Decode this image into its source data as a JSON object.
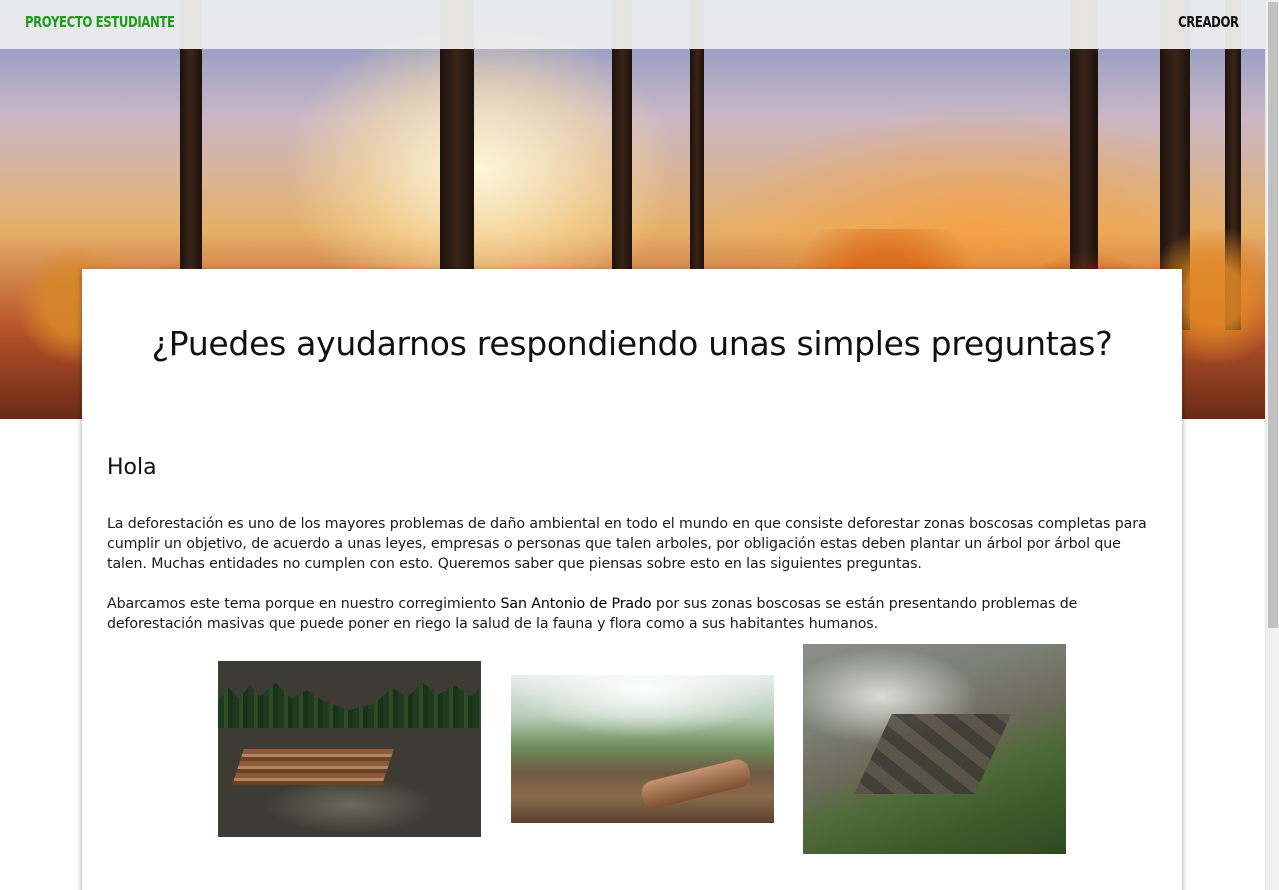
{
  "navbar": {
    "brand": "PROYECTO ESTUDIANTE",
    "link": "CREADOR",
    "brand_color": "#1f9a1f"
  },
  "card": {
    "title": "¿Puedes ayudarnos respondiendo unas simples preguntas?",
    "greeting": "Hola",
    "paragraph1": "La deforestación es uno de los mayores problemas de daño ambiental en todo el mundo en que consiste deforestar zonas boscosas completas para cumplir un objetivo, de acuerdo a unas leyes, empresas o personas que talen arboles, por obligación estas deben plantar un árbol por árbol que talen. Muchas entidades no cumplen con esto. Queremos saber que piensas sobre esto en las siguientes preguntas.",
    "paragraph2_before": "Abarcamos este tema porque en nuestro corregimiento ",
    "paragraph2_place": "San Antonio de Prado",
    "paragraph2_after": " por sus zonas boscosas se están presentando problemas de deforestación masivas que puede poner en riego la salud de la fauna y flora como a sus habitantes humanos."
  }
}
